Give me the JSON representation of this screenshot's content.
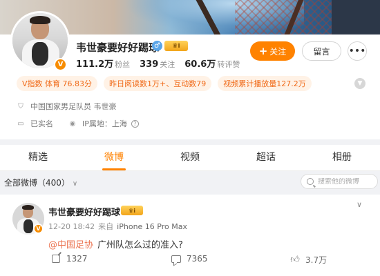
{
  "profile": {
    "name": "韦世豪要好好踢球",
    "verified_badge": "V",
    "gender_icon": "♂",
    "crown_badge": "♛i",
    "stats": [
      {
        "num": "111.2万",
        "label": "粉丝"
      },
      {
        "num": "339",
        "label": "关注"
      },
      {
        "num": "60.6万",
        "label": "转评赞"
      }
    ],
    "follow_label": "关注",
    "message_label": "留言",
    "more_label": "•••",
    "tags": [
      "V指数 体育 76.83分",
      "昨日阅读数1万+、互动数79",
      "视频累计播放量127.2万"
    ],
    "info_bio": "中国国家男足队员 韦世豪",
    "info_realname": "已实名",
    "info_ip": "IP属地：上海",
    "accent_color": "#ff8200"
  },
  "tabs": [
    {
      "label": "精选",
      "active": false
    },
    {
      "label": "微博",
      "active": true
    },
    {
      "label": "视频",
      "active": false
    },
    {
      "label": "超话",
      "active": false
    },
    {
      "label": "相册",
      "active": false
    }
  ],
  "filter": {
    "label": "全部微博（400）",
    "search_placeholder": "搜索他的微博"
  },
  "post": {
    "author": "韦世豪要好好踢球",
    "time": "12-20 18:42",
    "source_prefix": "来自",
    "device": "iPhone 16 Pro Max",
    "mention": "@中国足协",
    "text": "广州队怎么过的准入?",
    "reposts": "1327",
    "comments": "7365",
    "likes": "3.7万"
  }
}
